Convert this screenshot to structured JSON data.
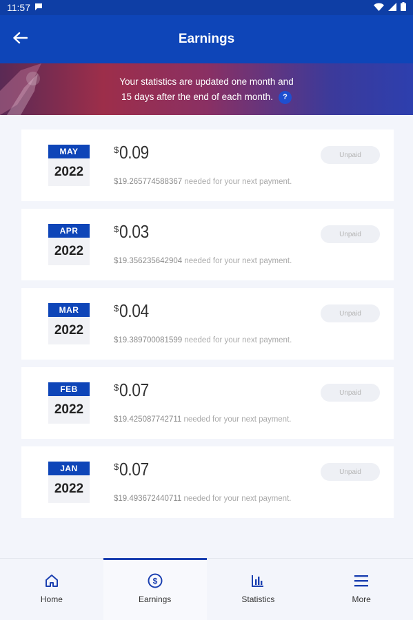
{
  "status_bar": {
    "time": "11:57"
  },
  "header": {
    "title": "Earnings"
  },
  "banner": {
    "line1": "Your statistics are updated one month and",
    "line2": "15 days after the end of each month.",
    "help_label": "?"
  },
  "earnings": [
    {
      "month": "MAY",
      "year": "2022",
      "currency": "$",
      "amount": "0.09",
      "needed_amount": "$19.265774588367",
      "needed_text": " needed for your next payment.",
      "status": "Unpaid"
    },
    {
      "month": "APR",
      "year": "2022",
      "currency": "$",
      "amount": "0.03",
      "needed_amount": "$19.356235642904",
      "needed_text": " needed for your next payment.",
      "status": "Unpaid"
    },
    {
      "month": "MAR",
      "year": "2022",
      "currency": "$",
      "amount": "0.04",
      "needed_amount": "$19.389700081599",
      "needed_text": " needed for your next payment.",
      "status": "Unpaid"
    },
    {
      "month": "FEB",
      "year": "2022",
      "currency": "$",
      "amount": "0.07",
      "needed_amount": "$19.425087742711",
      "needed_text": " needed for your next payment.",
      "status": "Unpaid"
    },
    {
      "month": "JAN",
      "year": "2022",
      "currency": "$",
      "amount": "0.07",
      "needed_amount": "$19.493672440711",
      "needed_text": " needed for your next payment.",
      "status": "Unpaid"
    }
  ],
  "bottom_nav": {
    "home": {
      "label": "Home",
      "icon": "home-icon"
    },
    "earnings": {
      "label": "Earnings",
      "icon": "dollar-circle-icon"
    },
    "statistics": {
      "label": "Statistics",
      "icon": "bar-chart-icon"
    },
    "more": {
      "label": "More",
      "icon": "menu-icon"
    }
  },
  "colors": {
    "primary": "#0e45b8",
    "status_bar": "#0e3ea5",
    "background": "#f3f5fb",
    "active_indicator": "#1a3fb0"
  }
}
